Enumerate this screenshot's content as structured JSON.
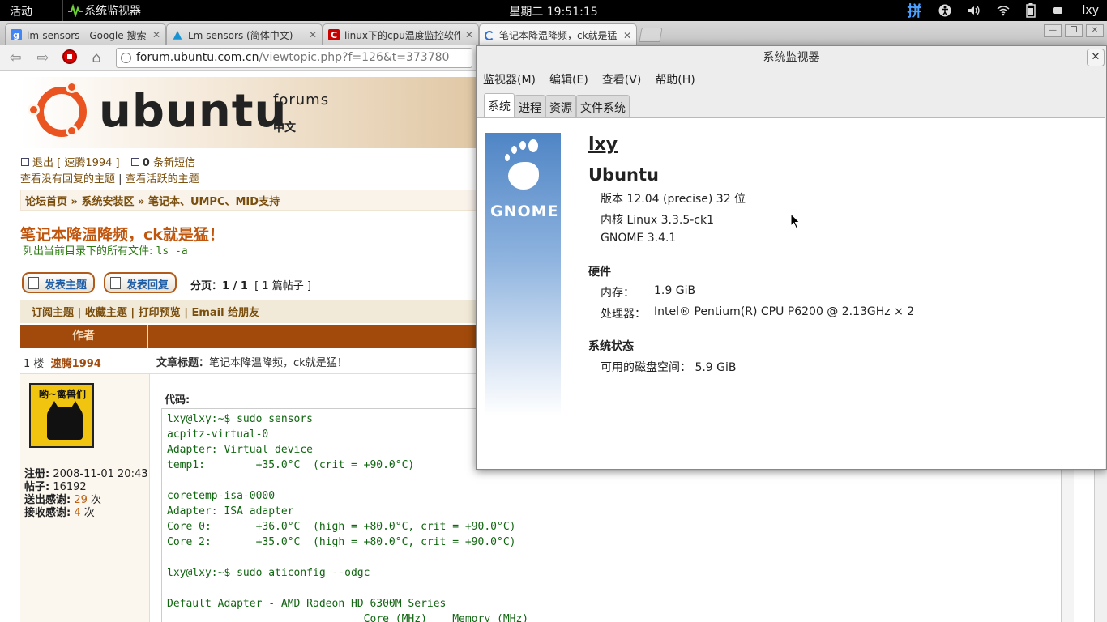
{
  "topbar": {
    "activities": "活动",
    "app_name": "系统监视器",
    "clock": "星期二 19:51:15",
    "ime": "拼",
    "user": "lxy"
  },
  "browser": {
    "tabs": [
      {
        "title": "lm-sensors - Google 搜索",
        "icon": "google-icon"
      },
      {
        "title": "Lm sensors (简体中文) -",
        "icon": "arch-icon"
      },
      {
        "title": "linux下的cpu温度监控软件",
        "icon": "csdn-icon"
      },
      {
        "title": "笔记本降温降频，ck就是猛",
        "icon": "loading-icon"
      }
    ],
    "url_host": "forum.ubuntu.com.cn",
    "url_path": "/viewtopic.php?f=126&t=373780"
  },
  "forum": {
    "logo_word": "ubuntu",
    "logo_forums": "forums",
    "logo_zh": "中文",
    "logout": "退出 [ 速腾1994 ]",
    "new_msgs_count": "0",
    "new_msgs": "条新短信",
    "no_reply": "查看没有回复的主题",
    "active_topics": "查看活跃的主题",
    "breadcrumb": [
      "论坛首页",
      "系统安装区",
      "笔记本、UMPC、MID支持"
    ],
    "topic_title": "笔记本降温降频，ck就是猛！",
    "signature": "列出当前目录下的所有文件:",
    "signature_code": "ls -a",
    "btn_new_topic": "发表主题",
    "btn_reply": "发表回复",
    "pages_label": "分页：",
    "pages_value": "1 / 1",
    "post_count": "[ 1 篇帖子 ]",
    "actions": [
      "订阅主题",
      "收藏主题",
      "打印预览",
      "Email 给朋友"
    ],
    "col_author": "作者",
    "floor": "1 楼",
    "author": "速腾1994",
    "article_title_label": "文章标题：",
    "article_title": "笔记本降温降频，ck就是猛！",
    "avatar_text": "哟~禽兽们",
    "reg_label": "注册:",
    "reg_value": "2008-11-01 20:43",
    "posts_label": "帖子:",
    "posts_value": "16192",
    "thanks_sent_label": "送出感谢:",
    "thanks_sent_value": "29",
    "thanks_recv_label": "接收感谢:",
    "thanks_recv_value": "4",
    "times_unit": "次",
    "code_label": "代码:",
    "code_lines": [
      "lxy@lxy:~$ sudo sensors",
      "acpitz-virtual-0",
      "Adapter: Virtual device",
      "temp1:        +35.0°C  (crit = +90.0°C)",
      "",
      "coretemp-isa-0000",
      "Adapter: ISA adapter",
      "Core 0:       +36.0°C  (high = +80.0°C, crit = +90.0°C)",
      "Core 2:       +35.0°C  (high = +80.0°C, crit = +90.0°C)",
      "",
      "lxy@lxy:~$ sudo aticonfig --odgc",
      "",
      "Default Adapter - AMD Radeon HD 6300M Series",
      "                               Core (MHz)    Memory (MHz)"
    ]
  },
  "sysmon": {
    "title": "系统监视器",
    "menus": [
      "监视器(M)",
      "编辑(E)",
      "查看(V)",
      "帮助(H)"
    ],
    "tabs": [
      "系统",
      "进程",
      "资源",
      "文件系统"
    ],
    "gnome_label": "GNOME",
    "hostname": "lxy",
    "os": "Ubuntu",
    "version": "版本 12.04 (precise) 32 位",
    "kernel": "内核 Linux 3.3.5-ck1",
    "gnome": "GNOME 3.4.1",
    "hw_heading": "硬件",
    "mem_label": "内存：",
    "mem_value": "1.9 GiB",
    "cpu_label": "处理器：",
    "cpu_value": "Intel® Pentium(R) CPU P6200 @ 2.13GHz × 2",
    "status_heading": "系统状态",
    "disk_label": "可用的磁盘空间：",
    "disk_value": "5.9 GiB"
  }
}
